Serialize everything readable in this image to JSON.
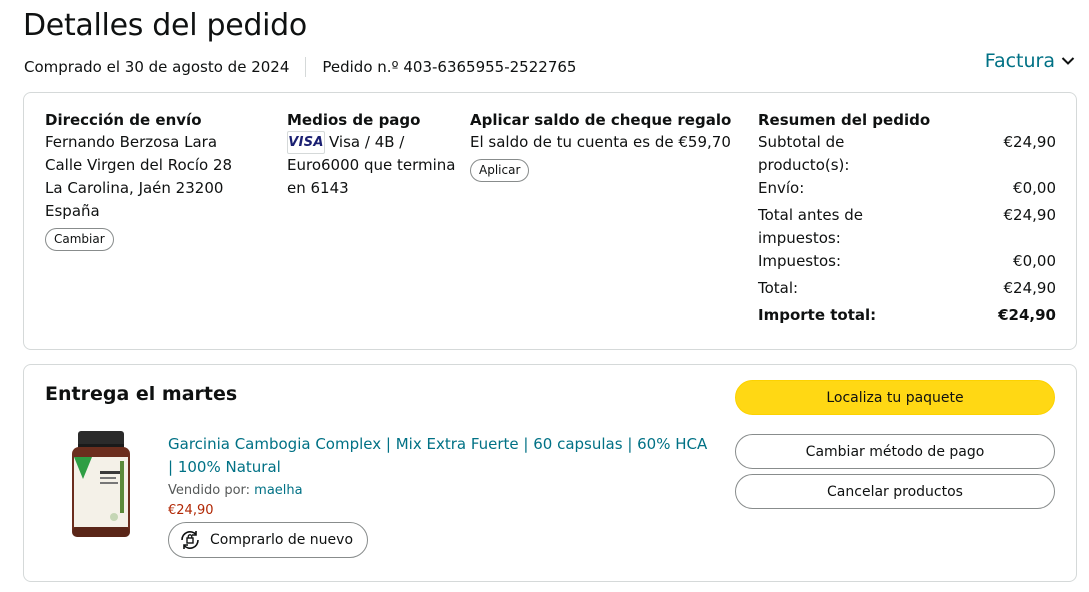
{
  "header": {
    "title": "Detalles del pedido",
    "purchased": "Comprado el 30 de agosto de 2024",
    "order_number": "Pedido n.º 403-6365955-2522765",
    "invoice_label": "Factura"
  },
  "shipping": {
    "heading": "Dirección de envío",
    "name": "Fernando Berzosa Lara",
    "street": "Calle Virgen del Rocío 28",
    "city": "La Carolina, Jaén 23200",
    "country": "España",
    "change_label": "Cambiar"
  },
  "payment": {
    "heading": "Medios de pago",
    "card_brand": "VISA",
    "text_line1": "Visa / 4B /",
    "text_line2": "Euro6000  que termina",
    "text_line3": "en 6143"
  },
  "gift": {
    "heading": "Aplicar saldo de cheque regalo",
    "balance_text": "El saldo de tu cuenta es de €59,70",
    "apply_label": "Aplicar"
  },
  "summary": {
    "heading": "Resumen del pedido",
    "rows": [
      {
        "label": "Subtotal de producto(s):",
        "value": "€24,90"
      },
      {
        "label": "Envío:",
        "value": "€0,00"
      },
      {
        "label": "Total antes de impuestos:",
        "value": "€24,90"
      },
      {
        "label": "Impuestos:",
        "value": "€0,00"
      },
      {
        "label": "Total:",
        "value": "€24,90"
      },
      {
        "label": "Importe total:",
        "value": "€24,90"
      }
    ]
  },
  "delivery": {
    "title": "Entrega el martes",
    "product_title": "Garcinia Cambogia Complex | Mix Extra Fuerte | 60 capsulas | 60% HCA | 100% Natural",
    "seller_prefix": "Vendido por:",
    "seller_name": "maelha",
    "price": "€24,90",
    "buy_again_label": "Comprarlo de nuevo",
    "track_label": "Localiza tu paquete",
    "change_payment_label": "Cambiar método de pago",
    "cancel_label": "Cancelar productos"
  },
  "colors": {
    "link": "#007185",
    "primary_button": "#ffd814",
    "price": "#b12704",
    "border": "#d5d9d9"
  },
  "icons": {
    "invoice_chevron": "chevron-down-icon",
    "buy_again": "buy-again-icon",
    "card": "visa-card-icon"
  }
}
